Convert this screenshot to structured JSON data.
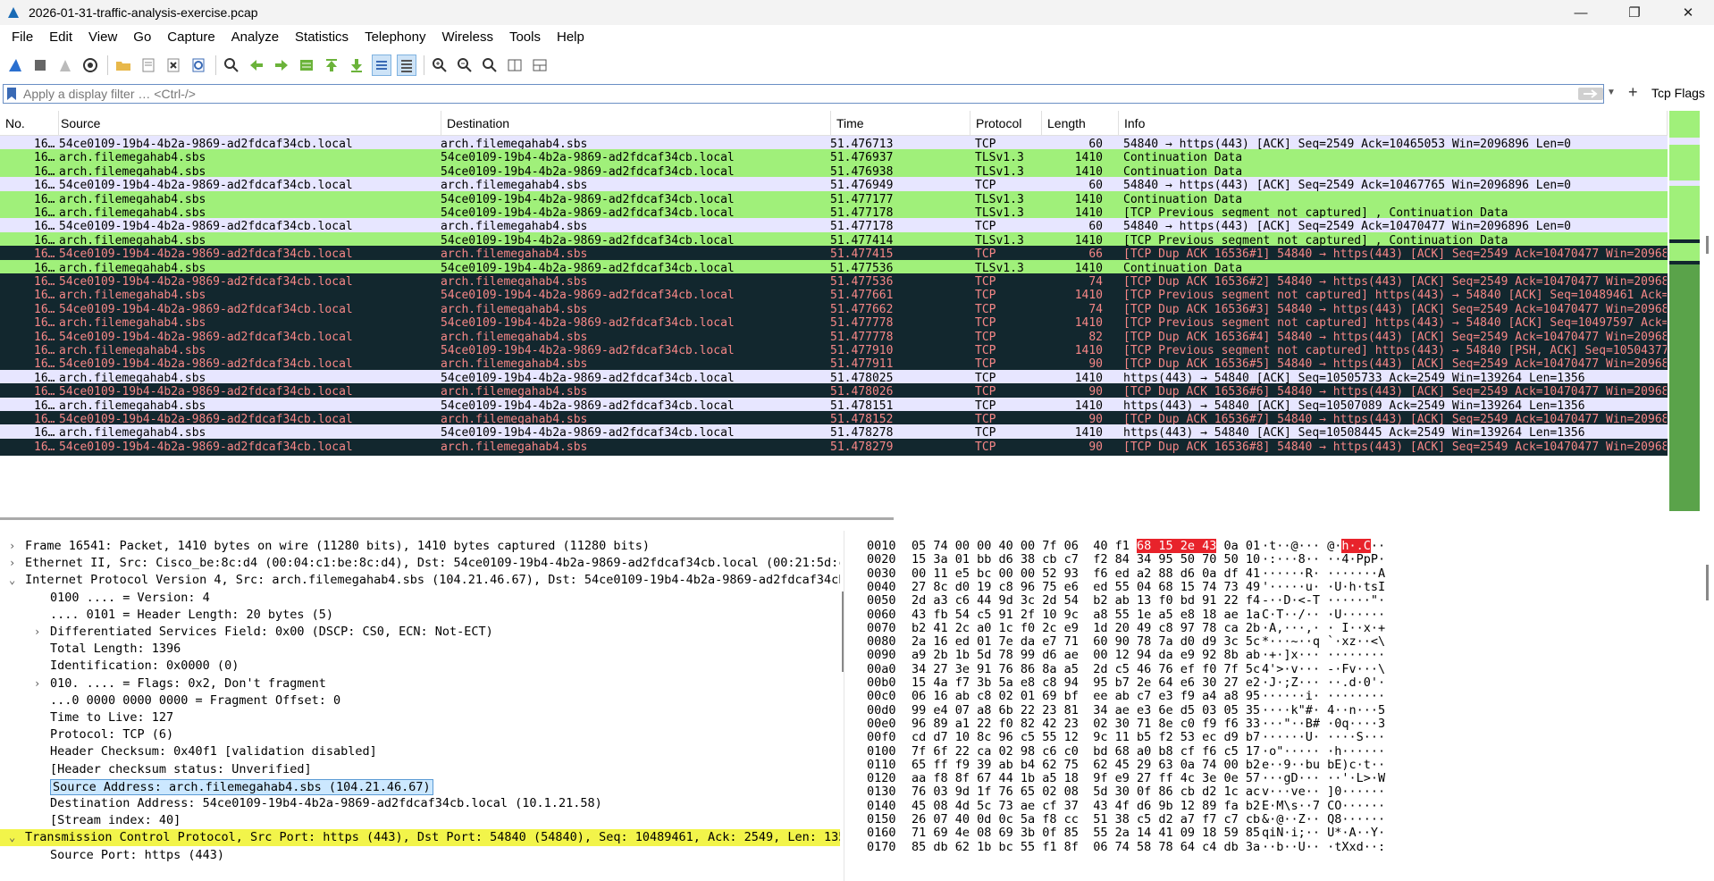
{
  "window": {
    "title": "2026-01-31-traffic-analysis-exercise.pcap",
    "minimize": "—",
    "maximize": "❐",
    "close": "✕"
  },
  "menu": [
    "File",
    "Edit",
    "View",
    "Go",
    "Capture",
    "Analyze",
    "Statistics",
    "Telephony",
    "Wireless",
    "Tools",
    "Help"
  ],
  "toolbar_icons": [
    "shark-fin-start-icon",
    "stop-square-icon",
    "restart-fin-icon",
    "capture-options-gear-icon",
    "open-folder-icon",
    "save-file-icon",
    "close-file-icon",
    "reload-icon",
    "find-magnifier-icon",
    "go-back-arrow-icon",
    "go-forward-arrow-icon",
    "go-to-packet-icon",
    "go-first-icon",
    "go-last-icon",
    "autoscroll-icon",
    "colorize-icon",
    "zoom-in-icon",
    "zoom-out-icon",
    "zoom-normal-icon",
    "resize-columns-icon",
    "layout-panes-icon"
  ],
  "filter": {
    "placeholder": "Apply a display filter … <Ctrl-/>",
    "tcp_flags_label": "Tcp Flags"
  },
  "packet_list": {
    "columns": [
      "No.",
      "Source",
      "Destination",
      "Time",
      "Protocol",
      "Length",
      "Info"
    ],
    "colors": {
      "tcp_bg": "#e7e6ff",
      "tls_bg": "#a0f07a",
      "bad_bg": "#12272e",
      "bad_fg": "#f78787"
    },
    "rows": [
      {
        "no": "16…",
        "src": "54ce0109-19b4-4b2a-9869-ad2fdcaf34cb.local",
        "dst": "arch.filemegahab4.sbs",
        "time": "51.476713",
        "proto": "TCP",
        "len": "60",
        "info": "54840 → https(443) [ACK] Seq=2549 Ack=10465053 Win=2096896 Len=0",
        "style": "tcp"
      },
      {
        "no": "16…",
        "src": "arch.filemegahab4.sbs",
        "dst": "54ce0109-19b4-4b2a-9869-ad2fdcaf34cb.local",
        "time": "51.476937",
        "proto": "TLSv1.3",
        "len": "1410",
        "info": "Continuation Data",
        "style": "tls"
      },
      {
        "no": "16…",
        "src": "arch.filemegahab4.sbs",
        "dst": "54ce0109-19b4-4b2a-9869-ad2fdcaf34cb.local",
        "time": "51.476938",
        "proto": "TLSv1.3",
        "len": "1410",
        "info": "Continuation Data",
        "style": "tls"
      },
      {
        "no": "16…",
        "src": "54ce0109-19b4-4b2a-9869-ad2fdcaf34cb.local",
        "dst": "arch.filemegahab4.sbs",
        "time": "51.476949",
        "proto": "TCP",
        "len": "60",
        "info": "54840 → https(443) [ACK] Seq=2549 Ack=10467765 Win=2096896 Len=0",
        "style": "tcp"
      },
      {
        "no": "16…",
        "src": "arch.filemegahab4.sbs",
        "dst": "54ce0109-19b4-4b2a-9869-ad2fdcaf34cb.local",
        "time": "51.477177",
        "proto": "TLSv1.3",
        "len": "1410",
        "info": "Continuation Data",
        "style": "tls"
      },
      {
        "no": "16…",
        "src": "arch.filemegahab4.sbs",
        "dst": "54ce0109-19b4-4b2a-9869-ad2fdcaf34cb.local",
        "time": "51.477178",
        "proto": "TLSv1.3",
        "len": "1410",
        "info": "[TCP Previous segment not captured] , Continuation Data",
        "style": "tls"
      },
      {
        "no": "16…",
        "src": "54ce0109-19b4-4b2a-9869-ad2fdcaf34cb.local",
        "dst": "arch.filemegahab4.sbs",
        "time": "51.477178",
        "proto": "TCP",
        "len": "60",
        "info": "54840 → https(443) [ACK] Seq=2549 Ack=10470477 Win=2096896 Len=0",
        "style": "tcp"
      },
      {
        "no": "16…",
        "src": "arch.filemegahab4.sbs",
        "dst": "54ce0109-19b4-4b2a-9869-ad2fdcaf34cb.local",
        "time": "51.477414",
        "proto": "TLSv1.3",
        "len": "1410",
        "info": "[TCP Previous segment not captured] , Continuation Data",
        "style": "tls"
      },
      {
        "no": "16…",
        "src": "54ce0109-19b4-4b2a-9869-ad2fdcaf34cb.local",
        "dst": "arch.filemegahab4.sbs",
        "time": "51.477415",
        "proto": "TCP",
        "len": "66",
        "info": "[TCP Dup ACK 16536#1] 54840 → https(443) [ACK] Seq=2549 Ack=10470477 Win=2096896",
        "style": "bad"
      },
      {
        "no": "16…",
        "src": "arch.filemegahab4.sbs",
        "dst": "54ce0109-19b4-4b2a-9869-ad2fdcaf34cb.local",
        "time": "51.477536",
        "proto": "TLSv1.3",
        "len": "1410",
        "info": "Continuation Data",
        "style": "tls"
      },
      {
        "no": "16…",
        "src": "54ce0109-19b4-4b2a-9869-ad2fdcaf34cb.local",
        "dst": "arch.filemegahab4.sbs",
        "time": "51.477536",
        "proto": "TCP",
        "len": "74",
        "info": "[TCP Dup ACK 16536#2] 54840 → https(443) [ACK] Seq=2549 Ack=10470477 Win=2096896",
        "style": "bad"
      },
      {
        "no": "16…",
        "src": "arch.filemegahab4.sbs",
        "dst": "54ce0109-19b4-4b2a-9869-ad2fdcaf34cb.local",
        "time": "51.477661",
        "proto": "TCP",
        "len": "1410",
        "info": "[TCP Previous segment not captured] https(443) → 54840 [ACK] Seq=10489461 Ack=254",
        "style": "bad"
      },
      {
        "no": "16…",
        "src": "54ce0109-19b4-4b2a-9869-ad2fdcaf34cb.local",
        "dst": "arch.filemegahab4.sbs",
        "time": "51.477662",
        "proto": "TCP",
        "len": "74",
        "info": "[TCP Dup ACK 16536#3] 54840 → https(443) [ACK] Seq=2549 Ack=10470477 Win=2096896",
        "style": "bad"
      },
      {
        "no": "16…",
        "src": "arch.filemegahab4.sbs",
        "dst": "54ce0109-19b4-4b2a-9869-ad2fdcaf34cb.local",
        "time": "51.477778",
        "proto": "TCP",
        "len": "1410",
        "info": "[TCP Previous segment not captured] https(443) → 54840 [ACK] Seq=10497597 Ack=254",
        "style": "bad"
      },
      {
        "no": "16…",
        "src": "54ce0109-19b4-4b2a-9869-ad2fdcaf34cb.local",
        "dst": "arch.filemegahab4.sbs",
        "time": "51.477778",
        "proto": "TCP",
        "len": "82",
        "info": "[TCP Dup ACK 16536#4] 54840 → https(443) [ACK] Seq=2549 Ack=10470477 Win=2096896",
        "style": "bad"
      },
      {
        "no": "16…",
        "src": "arch.filemegahab4.sbs",
        "dst": "54ce0109-19b4-4b2a-9869-ad2fdcaf34cb.local",
        "time": "51.477910",
        "proto": "TCP",
        "len": "1410",
        "info": "[TCP Previous segment not captured] https(443) → 54840 [PSH, ACK] Seq=10504377 Ac",
        "style": "bad"
      },
      {
        "no": "16…",
        "src": "54ce0109-19b4-4b2a-9869-ad2fdcaf34cb.local",
        "dst": "arch.filemegahab4.sbs",
        "time": "51.477911",
        "proto": "TCP",
        "len": "90",
        "info": "[TCP Dup ACK 16536#5] 54840 → https(443) [ACK] Seq=2549 Ack=10470477 Win=2096896",
        "style": "bad"
      },
      {
        "no": "16…",
        "src": "arch.filemegahab4.sbs",
        "dst": "54ce0109-19b4-4b2a-9869-ad2fdcaf34cb.local",
        "time": "51.478025",
        "proto": "TCP",
        "len": "1410",
        "info": "https(443) → 54840 [ACK] Seq=10505733 Ack=2549 Win=139264 Len=1356",
        "style": "tcp"
      },
      {
        "no": "16…",
        "src": "54ce0109-19b4-4b2a-9869-ad2fdcaf34cb.local",
        "dst": "arch.filemegahab4.sbs",
        "time": "51.478026",
        "proto": "TCP",
        "len": "90",
        "info": "[TCP Dup ACK 16536#6] 54840 → https(443) [ACK] Seq=2549 Ack=10470477 Win=2096896",
        "style": "bad"
      },
      {
        "no": "16…",
        "src": "arch.filemegahab4.sbs",
        "dst": "54ce0109-19b4-4b2a-9869-ad2fdcaf34cb.local",
        "time": "51.478151",
        "proto": "TCP",
        "len": "1410",
        "info": "https(443) → 54840 [ACK] Seq=10507089 Ack=2549 Win=139264 Len=1356",
        "style": "tcp"
      },
      {
        "no": "16…",
        "src": "54ce0109-19b4-4b2a-9869-ad2fdcaf34cb.local",
        "dst": "arch.filemegahab4.sbs",
        "time": "51.478152",
        "proto": "TCP",
        "len": "90",
        "info": "[TCP Dup ACK 16536#7] 54840 → https(443) [ACK] Seq=2549 Ack=10470477 Win=2096896",
        "style": "bad"
      },
      {
        "no": "16…",
        "src": "arch.filemegahab4.sbs",
        "dst": "54ce0109-19b4-4b2a-9869-ad2fdcaf34cb.local",
        "time": "51.478278",
        "proto": "TCP",
        "len": "1410",
        "info": "https(443) → 54840 [ACK] Seq=10508445 Ack=2549 Win=139264 Len=1356",
        "style": "tcp"
      },
      {
        "no": "16…",
        "src": "54ce0109-19b4-4b2a-9869-ad2fdcaf34cb.local",
        "dst": "arch.filemegahab4.sbs",
        "time": "51.478279",
        "proto": "TCP",
        "len": "90",
        "info": "[TCP Dup ACK 16536#8] 54840 → https(443) [ACK] Seq=2549 Ack=10470477 Win=2096896",
        "style": "bad"
      }
    ]
  },
  "details": [
    {
      "text": "Frame 16541: Packet, 1410 bytes on wire (11280 bits), 1410 bytes captured (11280 bits)",
      "toggle": "›",
      "indent": 0,
      "style": ""
    },
    {
      "text": "Ethernet II, Src: Cisco_be:8c:d4 (00:04:c1:be:8c:d4), Dst: 54ce0109-19b4-4b2a-9869-ad2fdcaf34cb.local (00:21:5d:c8:0e:f2",
      "toggle": "›",
      "indent": 0,
      "style": ""
    },
    {
      "text": "Internet Protocol Version 4, Src: arch.filemegahab4.sbs (104.21.46.67), Dst: 54ce0109-19b4-4b2a-9869-ad2fdcaf34cb.local",
      "toggle": "⌄",
      "indent": 0,
      "style": ""
    },
    {
      "text": "0100 .... = Version: 4",
      "toggle": "",
      "indent": 2,
      "style": ""
    },
    {
      "text": ".... 0101 = Header Length: 20 bytes (5)",
      "toggle": "",
      "indent": 2,
      "style": ""
    },
    {
      "text": "Differentiated Services Field: 0x00 (DSCP: CS0, ECN: Not-ECT)",
      "toggle": "›",
      "indent": 2,
      "style": ""
    },
    {
      "text": "Total Length: 1396",
      "toggle": "",
      "indent": 2,
      "style": ""
    },
    {
      "text": "Identification: 0x0000 (0)",
      "toggle": "",
      "indent": 2,
      "style": ""
    },
    {
      "text": "010. .... = Flags: 0x2, Don't fragment",
      "toggle": "›",
      "indent": 2,
      "style": ""
    },
    {
      "text": "...0 0000 0000 0000 = Fragment Offset: 0",
      "toggle": "",
      "indent": 2,
      "style": ""
    },
    {
      "text": "Time to Live: 127",
      "toggle": "",
      "indent": 2,
      "style": ""
    },
    {
      "text": "Protocol: TCP (6)",
      "toggle": "",
      "indent": 2,
      "style": ""
    },
    {
      "text": "Header Checksum: 0x40f1 [validation disabled]",
      "toggle": "",
      "indent": 2,
      "style": ""
    },
    {
      "text": "[Header checksum status: Unverified]",
      "toggle": "",
      "indent": 2,
      "style": ""
    },
    {
      "text": "Source Address: arch.filemegahab4.sbs (104.21.46.67)",
      "toggle": "",
      "indent": 2,
      "style": "selected"
    },
    {
      "text": "Destination Address: 54ce0109-19b4-4b2a-9869-ad2fdcaf34cb.local (10.1.21.58)",
      "toggle": "",
      "indent": 2,
      "style": ""
    },
    {
      "text": "[Stream index: 40]",
      "toggle": "",
      "indent": 2,
      "style": ""
    },
    {
      "text": "Transmission Control Protocol, Src Port: https (443), Dst Port: 54840 (54840), Seq: 10489461, Ack: 2549, Len: 1356",
      "toggle": "⌄",
      "indent": 0,
      "style": "yellow"
    },
    {
      "text": "Source Port: https (443)",
      "toggle": "",
      "indent": 2,
      "style": ""
    },
    {
      "text": "Destination Port: 54840 (54840)",
      "toggle": "",
      "indent": 2,
      "style": ""
    }
  ],
  "bytes": [
    {
      "off": "0010",
      "pre": "05 74 00 00 40 00 7f 06  40 f1 ",
      "hl": "68 15 2e 43",
      "post": " 0a 01",
      "apre": "·t··@··· @·",
      "ahl": "h·.C",
      "apost": "··"
    },
    {
      "off": "0020",
      "pre": "15 3a 01 bb d6 38 cb c7  f2 84 34 95 50 70 50 10",
      "hl": "",
      "post": "",
      "apre": "·:···8·· ··4·PpP·",
      "ahl": "",
      "apost": ""
    },
    {
      "off": "0030",
      "pre": "00 11 e5 bc 00 00 52 93  f6 ed a2 88 d6 0a df 41",
      "hl": "",
      "post": "",
      "apre": "······R· ·······A",
      "ahl": "",
      "apost": ""
    },
    {
      "off": "0040",
      "pre": "27 8c d0 19 c8 96 75 e6  ed 55 04 68 15 74 73 49",
      "hl": "",
      "post": "",
      "apre": "'·····u· ·U·h·tsI",
      "ahl": "",
      "apost": ""
    },
    {
      "off": "0050",
      "pre": "2d a3 c6 44 9d 3c 2d 54  b2 ab 13 f0 bd 91 22 f4",
      "hl": "",
      "post": "",
      "apre": "-··D·<-T ······\"·",
      "ahl": "",
      "apost": ""
    },
    {
      "off": "0060",
      "pre": "43 fb 54 c5 91 2f 10 9c  a8 55 1e a5 e8 18 ae 1a",
      "hl": "",
      "post": "",
      "apre": "C·T··/·· ·U······",
      "ahl": "",
      "apost": ""
    },
    {
      "off": "0070",
      "pre": "b2 41 2c a0 1c f0 2c e9  1d 20 49 c8 97 78 ca 2b",
      "hl": "",
      "post": "",
      "apre": "·A,···,· · I··x·+",
      "ahl": "",
      "apost": ""
    },
    {
      "off": "0080",
      "pre": "2a 16 ed 01 7e da e7 71  60 90 78 7a d0 d9 3c 5c",
      "hl": "",
      "post": "",
      "apre": "*···~··q `·xz··<\\",
      "ahl": "",
      "apost": ""
    },
    {
      "off": "0090",
      "pre": "a9 2b 1b 5d 78 99 d6 ae  00 12 94 da e9 92 8b ab",
      "hl": "",
      "post": "",
      "apre": "·+·]x··· ········",
      "ahl": "",
      "apost": ""
    },
    {
      "off": "00a0",
      "pre": "34 27 3e 91 76 86 8a a5  2d c5 46 76 ef f0 7f 5c",
      "hl": "",
      "post": "",
      "apre": "4'>·v··· -·Fv···\\",
      "ahl": "",
      "apost": ""
    },
    {
      "off": "00b0",
      "pre": "15 4a f7 3b 5a e8 c8 94  95 b7 2e 64 e6 30 27 e2",
      "hl": "",
      "post": "",
      "apre": "·J·;Z··· ··.d·0'·",
      "ahl": "",
      "apost": ""
    },
    {
      "off": "00c0",
      "pre": "06 16 ab c8 02 01 69 bf  ee ab c7 e3 f9 a4 a8 95",
      "hl": "",
      "post": "",
      "apre": "······i· ········",
      "ahl": "",
      "apost": ""
    },
    {
      "off": "00d0",
      "pre": "99 e4 07 a8 6b 22 23 81  34 ae e3 6e d5 03 05 35",
      "hl": "",
      "post": "",
      "apre": "····k\"#· 4··n···5",
      "ahl": "",
      "apost": ""
    },
    {
      "off": "00e0",
      "pre": "96 89 a1 22 f0 82 42 23  02 30 71 8e c0 f9 f6 33",
      "hl": "",
      "post": "",
      "apre": "···\"··B# ·0q····3",
      "ahl": "",
      "apost": ""
    },
    {
      "off": "00f0",
      "pre": "cd d7 10 8c 96 c5 55 12  9c 11 b5 f2 53 ec d9 b7",
      "hl": "",
      "post": "",
      "apre": "······U· ····S···",
      "ahl": "",
      "apost": ""
    },
    {
      "off": "0100",
      "pre": "7f 6f 22 ca 02 98 c6 c0  bd 68 a0 b8 cf f6 c5 17",
      "hl": "",
      "post": "",
      "apre": "·o\"····· ·h······",
      "ahl": "",
      "apost": ""
    },
    {
      "off": "0110",
      "pre": "65 ff f9 39 ab b4 62 75  62 45 29 63 0a 74 00 b2",
      "hl": "",
      "post": "",
      "apre": "e··9··bu bE)c·t··",
      "ahl": "",
      "apost": ""
    },
    {
      "off": "0120",
      "pre": "aa f8 8f 67 44 1b a5 18  9f e9 27 ff 4c 3e 0e 57",
      "hl": "",
      "post": "",
      "apre": "···gD··· ··'·L>·W",
      "ahl": "",
      "apost": ""
    },
    {
      "off": "0130",
      "pre": "76 03 9d 1f 76 65 02 08  5d 30 0f 86 cb d2 1c ac",
      "hl": "",
      "post": "",
      "apre": "v···ve·· ]0······",
      "ahl": "",
      "apost": ""
    },
    {
      "off": "0140",
      "pre": "45 08 4d 5c 73 ae cf 37  43 4f d6 9b 12 89 fa b2",
      "hl": "",
      "post": "",
      "apre": "E·M\\s··7 CO······",
      "ahl": "",
      "apost": ""
    },
    {
      "off": "0150",
      "pre": "26 07 40 0d 0c 5a f8 cc  51 38 c5 d2 a7 f7 c7 cb",
      "hl": "",
      "post": "",
      "apre": "&·@··Z·· Q8······",
      "ahl": "",
      "apost": ""
    },
    {
      "off": "0160",
      "pre": "71 69 4e 08 69 3b 0f 85  55 2a 14 41 09 18 59 85",
      "hl": "",
      "post": "",
      "apre": "qiN·i;·· U*·A··Y·",
      "ahl": "",
      "apost": ""
    },
    {
      "off": "0170",
      "pre": "85 db 62 1b bc 55 f1 8f  06 74 58 78 64 c4 db 3a",
      "hl": "",
      "post": "",
      "apre": "··b··U·· ·tXxd··:",
      "ahl": "",
      "apost": ""
    }
  ]
}
